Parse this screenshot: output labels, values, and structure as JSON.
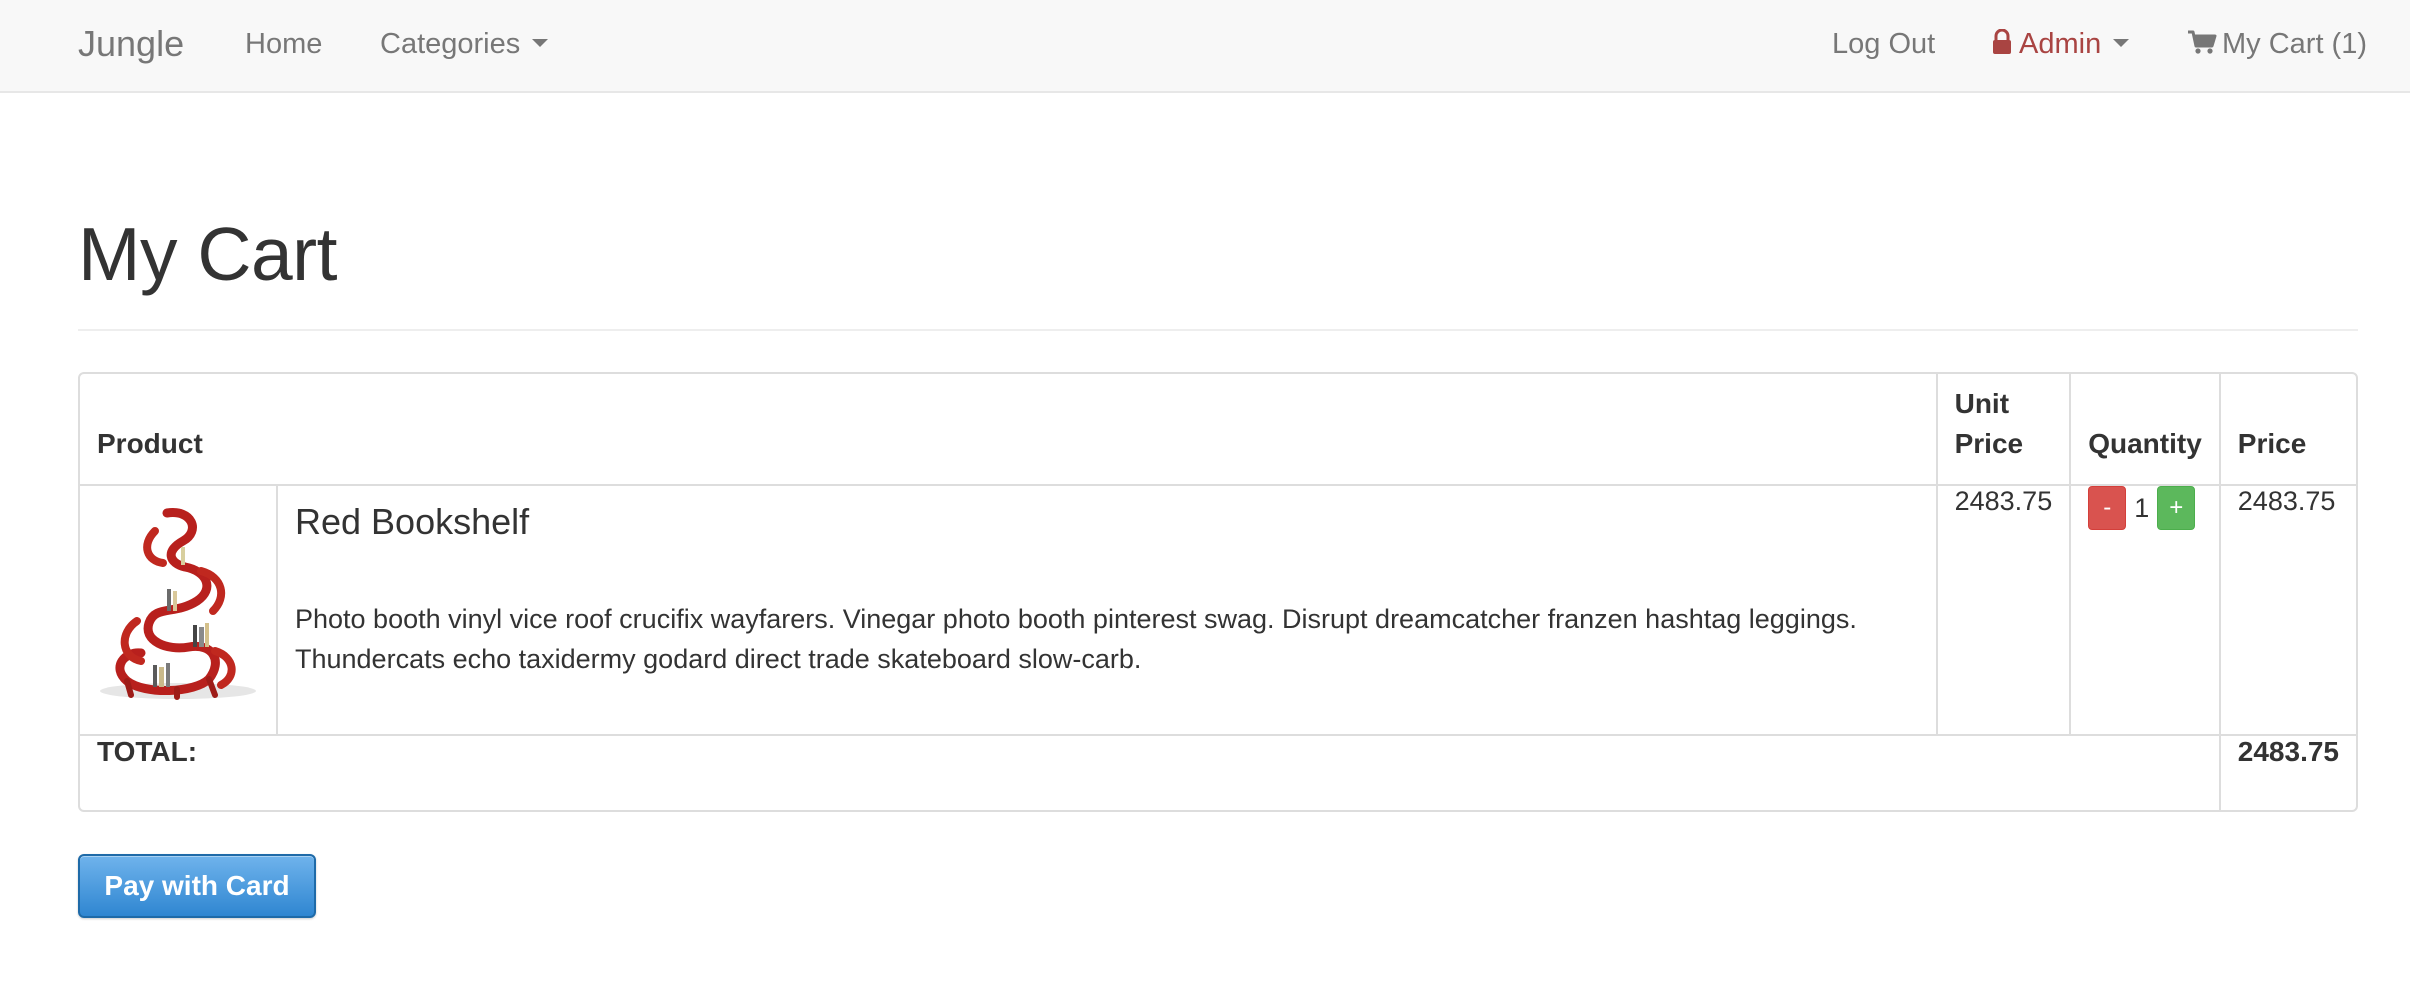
{
  "navbar": {
    "brand": "Jungle",
    "home": "Home",
    "categories": "Categories",
    "logout": "Log Out",
    "admin": "Admin",
    "cart": "My Cart (1)",
    "admin_color": "#a94442"
  },
  "page": {
    "title": "My Cart"
  },
  "table": {
    "headers": {
      "product": "Product",
      "unit_price_line1": "Unit",
      "unit_price_line2": "Price",
      "quantity": "Quantity",
      "price": "Price"
    },
    "items": [
      {
        "image_icon": "red-bookshelf-image",
        "name": "Red Bookshelf",
        "description": "Photo booth vinyl vice roof crucifix wayfarers. Vinegar photo booth pinterest swag. Disrupt dreamcatcher franzen hashtag leggings. Thundercats echo taxidermy godard direct trade skateboard slow-carb.",
        "unit_price": "2483.75",
        "decrease_label": "-",
        "quantity": "1",
        "increase_label": "+",
        "price": "2483.75"
      }
    ],
    "total_label": "TOTAL:",
    "total_value": "2483.75"
  },
  "checkout": {
    "pay_label": "Pay with Card",
    "accent": "#2f86d1"
  }
}
